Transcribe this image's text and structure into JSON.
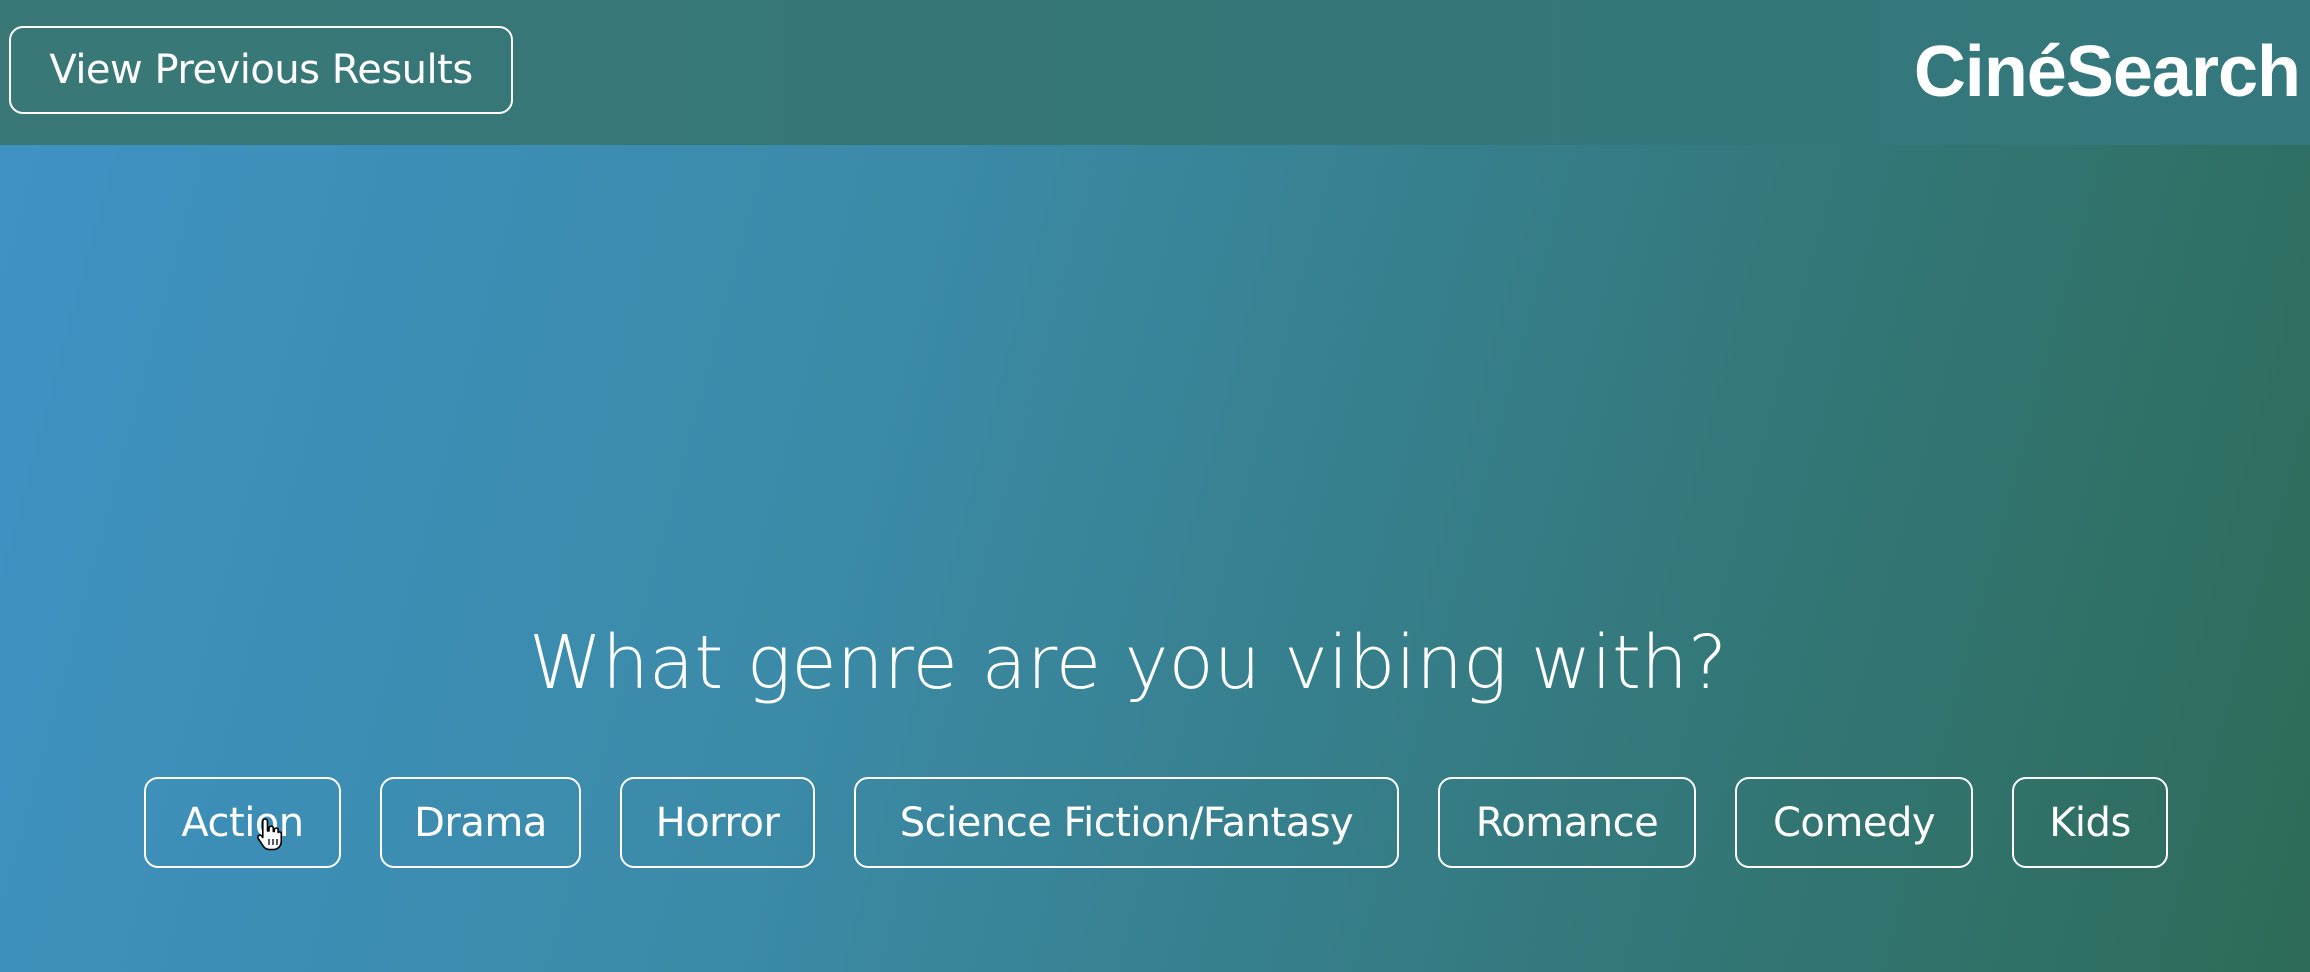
{
  "header": {
    "prev_results_label": "View Previous Results",
    "brand": "CinéSearch"
  },
  "main": {
    "question": "What genre are you vibing with?",
    "genres": [
      {
        "label": "Action"
      },
      {
        "label": "Drama"
      },
      {
        "label": "Horror"
      },
      {
        "label": "Science Fiction/Fantasy"
      },
      {
        "label": "Romance"
      },
      {
        "label": "Comedy"
      },
      {
        "label": "Kids"
      }
    ]
  },
  "cursor": {
    "icon": "hand-pointer-icon"
  },
  "colors": {
    "header_bg": "#357677",
    "gradient_left": "#3f92c4",
    "gradient_right": "#2e6b58",
    "text": "#ffffff"
  }
}
